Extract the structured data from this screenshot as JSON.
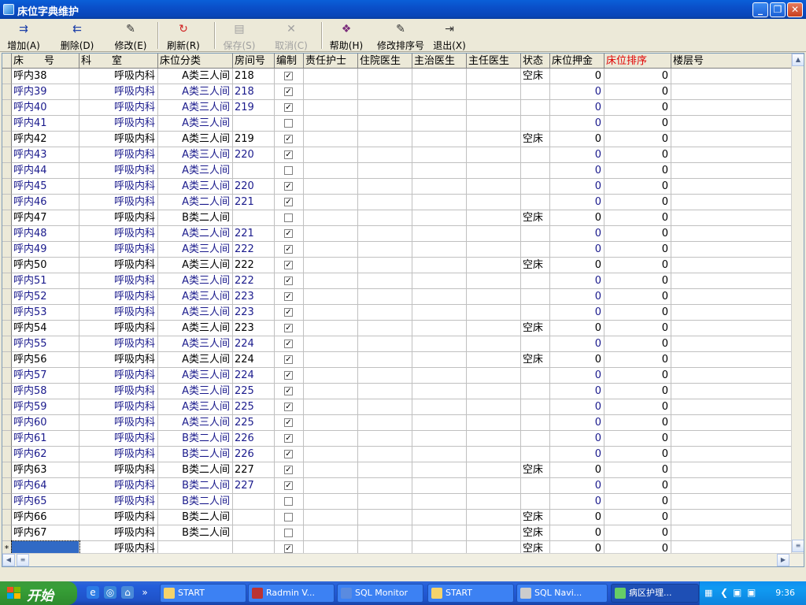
{
  "window": {
    "title": "床位字典维护"
  },
  "toolbar": [
    {
      "label": "增加(A)",
      "icon": "add-icon",
      "enabled": true
    },
    {
      "label": "删除(D)",
      "icon": "delete-icon",
      "enabled": true
    },
    {
      "label": "修改(E)",
      "icon": "edit-icon",
      "enabled": true
    },
    {
      "label": "刷新(R)",
      "icon": "refresh-icon",
      "enabled": true
    },
    {
      "label": "保存(S)",
      "icon": "save-icon",
      "enabled": false
    },
    {
      "label": "取消(C)",
      "icon": "cancel-icon",
      "enabled": false
    },
    {
      "label": "帮助(H)",
      "icon": "help-icon",
      "enabled": true
    },
    {
      "label": "修改排序号",
      "icon": "sort-edit-icon",
      "enabled": true
    },
    {
      "label": "退出(X)",
      "icon": "exit-icon",
      "enabled": true
    }
  ],
  "columns": [
    "床　　号",
    "科　　室",
    "床位分类",
    "房间号",
    "编制",
    "责任护士",
    "住院医生",
    "主治医生",
    "主任医生",
    "状态",
    "床位押金",
    "床位排序",
    "楼层号"
  ],
  "rows": [
    {
      "bed": "呼内38",
      "dept": "呼吸内科",
      "cat": "A类三人间",
      "room": "218",
      "comp": true,
      "status": "空床",
      "deposit": "0",
      "order": "0",
      "color": "black"
    },
    {
      "bed": "呼内39",
      "dept": "呼吸内科",
      "cat": "A类三人间",
      "room": "218",
      "comp": true,
      "status": "",
      "deposit": "0",
      "order": "0",
      "color": "blue"
    },
    {
      "bed": "呼内40",
      "dept": "呼吸内科",
      "cat": "A类三人间",
      "room": "219",
      "comp": true,
      "status": "",
      "deposit": "0",
      "order": "0",
      "color": "blue"
    },
    {
      "bed": "呼内41",
      "dept": "呼吸内科",
      "cat": "A类三人间",
      "room": "",
      "comp": false,
      "status": "",
      "deposit": "0",
      "order": "0",
      "color": "blue"
    },
    {
      "bed": "呼内42",
      "dept": "呼吸内科",
      "cat": "A类三人间",
      "room": "219",
      "comp": true,
      "status": "空床",
      "deposit": "0",
      "order": "0",
      "color": "black"
    },
    {
      "bed": "呼内43",
      "dept": "呼吸内科",
      "cat": "A类三人间",
      "room": "220",
      "comp": true,
      "status": "",
      "deposit": "0",
      "order": "0",
      "color": "blue"
    },
    {
      "bed": "呼内44",
      "dept": "呼吸内科",
      "cat": "A类三人间",
      "room": "",
      "comp": false,
      "status": "",
      "deposit": "0",
      "order": "0",
      "color": "blue"
    },
    {
      "bed": "呼内45",
      "dept": "呼吸内科",
      "cat": "A类三人间",
      "room": "220",
      "comp": true,
      "status": "",
      "deposit": "0",
      "order": "0",
      "color": "blue"
    },
    {
      "bed": "呼内46",
      "dept": "呼吸内科",
      "cat": "A类二人间",
      "room": "221",
      "comp": true,
      "status": "",
      "deposit": "0",
      "order": "0",
      "color": "blue"
    },
    {
      "bed": "呼内47",
      "dept": "呼吸内科",
      "cat": "B类二人间",
      "room": "",
      "comp": false,
      "status": "空床",
      "deposit": "0",
      "order": "0",
      "color": "black"
    },
    {
      "bed": "呼内48",
      "dept": "呼吸内科",
      "cat": "A类二人间",
      "room": "221",
      "comp": true,
      "status": "",
      "deposit": "0",
      "order": "0",
      "color": "blue"
    },
    {
      "bed": "呼内49",
      "dept": "呼吸内科",
      "cat": "A类三人间",
      "room": "222",
      "comp": true,
      "status": "",
      "deposit": "0",
      "order": "0",
      "color": "blue"
    },
    {
      "bed": "呼内50",
      "dept": "呼吸内科",
      "cat": "A类三人间",
      "room": "222",
      "comp": true,
      "status": "空床",
      "deposit": "0",
      "order": "0",
      "color": "black"
    },
    {
      "bed": "呼内51",
      "dept": "呼吸内科",
      "cat": "A类三人间",
      "room": "222",
      "comp": true,
      "status": "",
      "deposit": "0",
      "order": "0",
      "color": "blue"
    },
    {
      "bed": "呼内52",
      "dept": "呼吸内科",
      "cat": "A类三人间",
      "room": "223",
      "comp": true,
      "status": "",
      "deposit": "0",
      "order": "0",
      "color": "blue"
    },
    {
      "bed": "呼内53",
      "dept": "呼吸内科",
      "cat": "A类三人间",
      "room": "223",
      "comp": true,
      "status": "",
      "deposit": "0",
      "order": "0",
      "color": "blue"
    },
    {
      "bed": "呼内54",
      "dept": "呼吸内科",
      "cat": "A类三人间",
      "room": "223",
      "comp": true,
      "status": "空床",
      "deposit": "0",
      "order": "0",
      "color": "black"
    },
    {
      "bed": "呼内55",
      "dept": "呼吸内科",
      "cat": "A类三人间",
      "room": "224",
      "comp": true,
      "status": "",
      "deposit": "0",
      "order": "0",
      "color": "blue"
    },
    {
      "bed": "呼内56",
      "dept": "呼吸内科",
      "cat": "A类三人间",
      "room": "224",
      "comp": true,
      "status": "空床",
      "deposit": "0",
      "order": "0",
      "color": "black"
    },
    {
      "bed": "呼内57",
      "dept": "呼吸内科",
      "cat": "A类三人间",
      "room": "224",
      "comp": true,
      "status": "",
      "deposit": "0",
      "order": "0",
      "color": "blue"
    },
    {
      "bed": "呼内58",
      "dept": "呼吸内科",
      "cat": "A类三人间",
      "room": "225",
      "comp": true,
      "status": "",
      "deposit": "0",
      "order": "0",
      "color": "blue"
    },
    {
      "bed": "呼内59",
      "dept": "呼吸内科",
      "cat": "A类三人间",
      "room": "225",
      "comp": true,
      "status": "",
      "deposit": "0",
      "order": "0",
      "color": "blue"
    },
    {
      "bed": "呼内60",
      "dept": "呼吸内科",
      "cat": "A类三人间",
      "room": "225",
      "comp": true,
      "status": "",
      "deposit": "0",
      "order": "0",
      "color": "blue"
    },
    {
      "bed": "呼内61",
      "dept": "呼吸内科",
      "cat": "B类二人间",
      "room": "226",
      "comp": true,
      "status": "",
      "deposit": "0",
      "order": "0",
      "color": "blue"
    },
    {
      "bed": "呼内62",
      "dept": "呼吸内科",
      "cat": "B类二人间",
      "room": "226",
      "comp": true,
      "status": "",
      "deposit": "0",
      "order": "0",
      "color": "blue"
    },
    {
      "bed": "呼内63",
      "dept": "呼吸内科",
      "cat": "B类二人间",
      "room": "227",
      "comp": true,
      "status": "空床",
      "deposit": "0",
      "order": "0",
      "color": "black"
    },
    {
      "bed": "呼内64",
      "dept": "呼吸内科",
      "cat": "B类二人间",
      "room": "227",
      "comp": true,
      "status": "",
      "deposit": "0",
      "order": "0",
      "color": "blue"
    },
    {
      "bed": "呼内65",
      "dept": "呼吸内科",
      "cat": "B类二人间",
      "room": "",
      "comp": false,
      "status": "",
      "deposit": "0",
      "order": "0",
      "color": "blue"
    },
    {
      "bed": "呼内66",
      "dept": "呼吸内科",
      "cat": "B类二人间",
      "room": "",
      "comp": false,
      "status": "空床",
      "deposit": "0",
      "order": "0",
      "color": "black"
    },
    {
      "bed": "呼内67",
      "dept": "呼吸内科",
      "cat": "B类二人间",
      "room": "",
      "comp": false,
      "status": "空床",
      "deposit": "0",
      "order": "0",
      "color": "black"
    },
    {
      "bed": "",
      "dept": "呼吸内科",
      "cat": "",
      "room": "",
      "comp": true,
      "status": "空床",
      "deposit": "0",
      "order": "0",
      "color": "black",
      "newrow": true
    }
  ],
  "newrow_marker": "*",
  "taskbar": {
    "start_label": "开始",
    "tasks": [
      {
        "label": "START",
        "icon": "folder-icon"
      },
      {
        "label": "Radmin V...",
        "icon": "radmin-icon"
      },
      {
        "label": "SQL Monitor",
        "icon": "sql-monitor-icon"
      },
      {
        "label": "START",
        "icon": "folder-icon"
      },
      {
        "label": "SQL Navi...",
        "icon": "sql-navigator-icon"
      },
      {
        "label": "病区护理...",
        "icon": "app-icon",
        "active": true
      }
    ],
    "clock": "9:36"
  },
  "colors": {
    "blue_text": "#1a1a8c",
    "sort_header": "#e00000",
    "selection": "#316ac5"
  }
}
